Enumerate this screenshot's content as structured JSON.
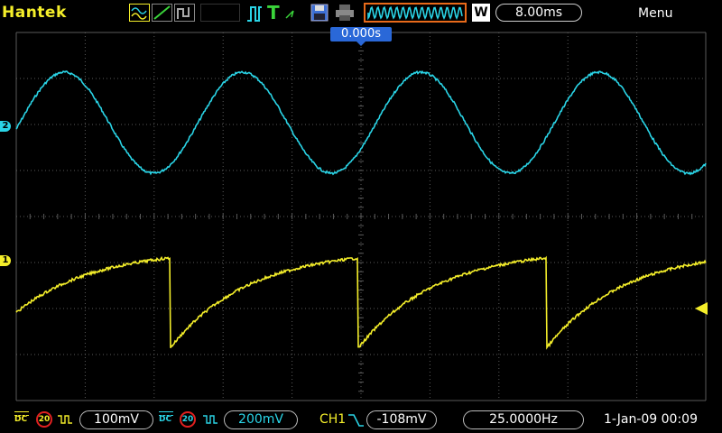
{
  "brand": "Hantek",
  "top": {
    "timebase": "8.00ms",
    "w_label": "W",
    "menu": "Menu",
    "trigger_position": "0.000s"
  },
  "ch1": {
    "marker": "1",
    "coupling": "DC",
    "bw_limit": "20",
    "volts_div": "100mV",
    "color": "#f4ee2a"
  },
  "ch2": {
    "marker": "2",
    "coupling": "DC",
    "bw_limit": "20",
    "volts_div": "200mV",
    "color": "#2ad4e6"
  },
  "trigger": {
    "source": "CH1",
    "level": "-108mV"
  },
  "frequency": "25.0000Hz",
  "datetime": "1-Jan-09 00:09",
  "colors": {
    "grid": "#5a5a5a",
    "accent_orange": "#e86a1a",
    "trigger_blue": "#2a68d8"
  }
}
